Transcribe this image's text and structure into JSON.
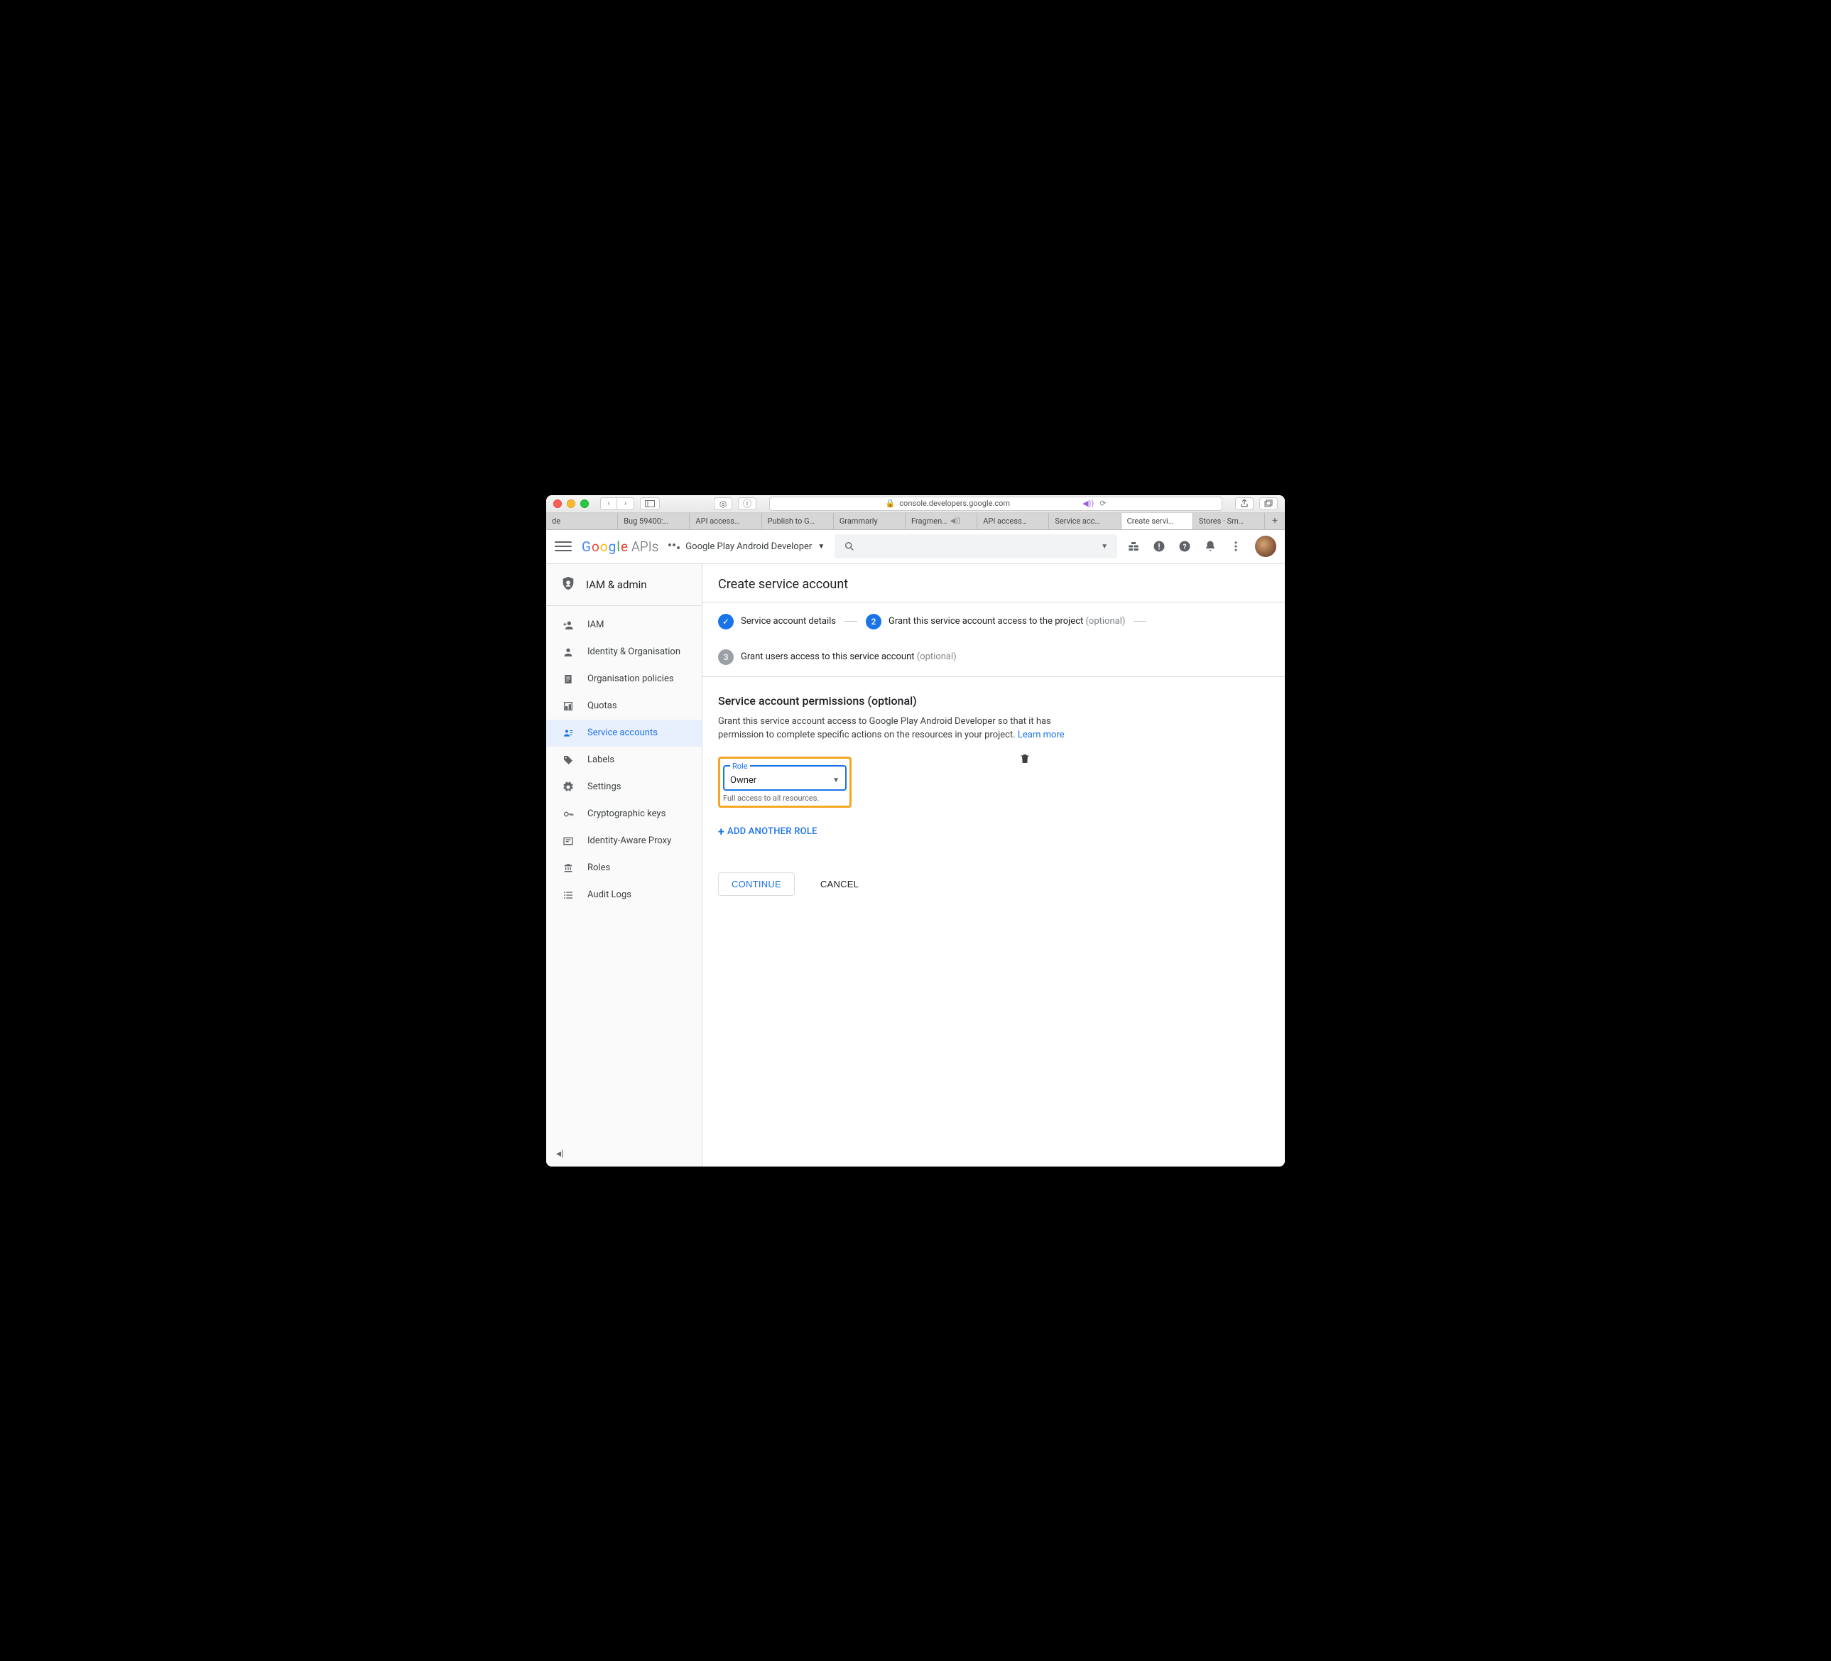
{
  "browser": {
    "address": "console.developers.google.com",
    "tabs": [
      "de",
      "Bug 59400:…",
      "API access…",
      "Publish to G…",
      "Grammarly",
      "Fragmen…",
      "API access…",
      "Service acc…",
      "Create servi…",
      "Stores · Sm…"
    ],
    "active_tab_index": 8
  },
  "header": {
    "logo_apis": "APIs",
    "project": "Google Play Android Developer"
  },
  "sidebar": {
    "section": "IAM & admin",
    "items": [
      {
        "label": "IAM"
      },
      {
        "label": "Identity & Organisation"
      },
      {
        "label": "Organisation policies"
      },
      {
        "label": "Quotas"
      },
      {
        "label": "Service accounts"
      },
      {
        "label": "Labels"
      },
      {
        "label": "Settings"
      },
      {
        "label": "Cryptographic keys"
      },
      {
        "label": "Identity-Aware Proxy"
      },
      {
        "label": "Roles"
      },
      {
        "label": "Audit Logs"
      }
    ],
    "active_index": 4
  },
  "page": {
    "title": "Create service account",
    "steps": {
      "s1": "Service account details",
      "s2": "Grant this service account access to the project",
      "s2_optional": "(optional)",
      "s3": "Grant users access to this service account",
      "s3_optional": "(optional)"
    },
    "perm_heading": "Service account permissions (optional)",
    "perm_desc": "Grant this service account access to Google Play Android Developer so that it has permission to complete specific actions on the resources in your project. ",
    "learn_more": "Learn more",
    "role_label": "Role",
    "role_value": "Owner",
    "role_hint": "Full access to all resources.",
    "add_role": "ADD ANOTHER ROLE",
    "continue": "CONTINUE",
    "cancel": "CANCEL"
  }
}
